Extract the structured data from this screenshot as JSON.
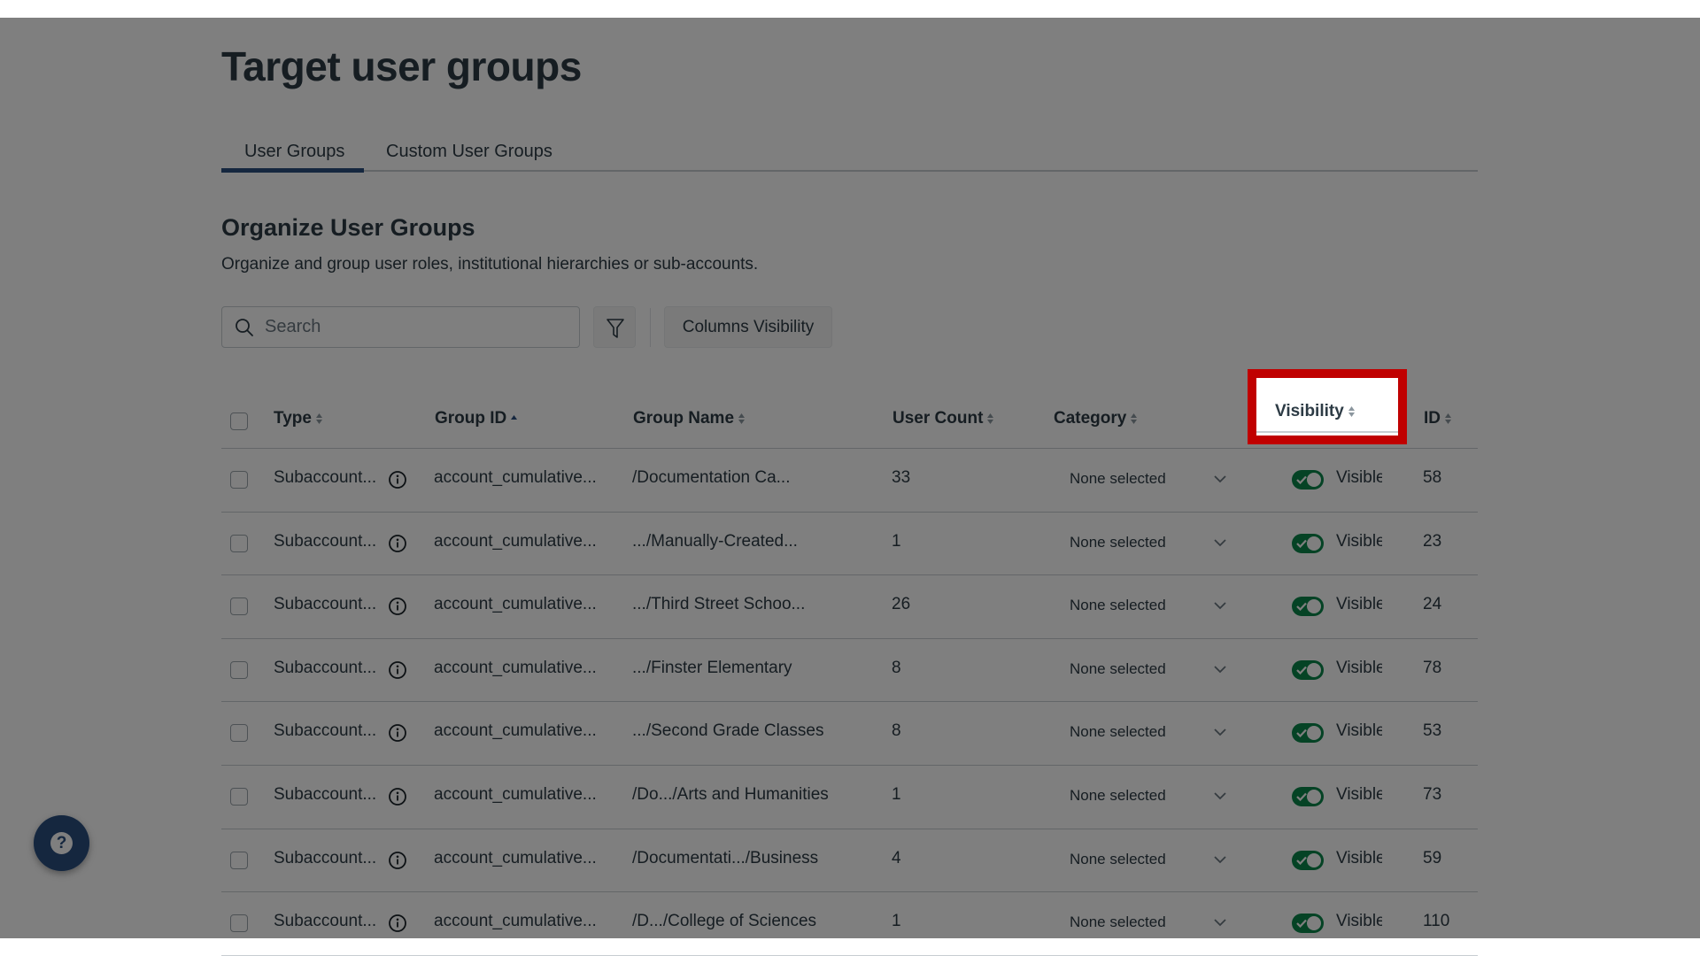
{
  "page": {
    "title": "Target user groups"
  },
  "tabs": [
    {
      "label": "User Groups",
      "active": true
    },
    {
      "label": "Custom User Groups",
      "active": false
    }
  ],
  "section": {
    "title": "Organize User Groups",
    "description": "Organize and group user roles, institutional hierarchies or sub-accounts."
  },
  "toolbar": {
    "search_placeholder": "Search",
    "search_value": "",
    "filter_icon": "filter-funnel-icon",
    "columns_visibility_label": "Columns Visibility"
  },
  "table": {
    "columns": [
      {
        "label": "Type",
        "sort": "none"
      },
      {
        "label": "Group ID",
        "sort": "ascending"
      },
      {
        "label": "Group Name",
        "sort": "none"
      },
      {
        "label": "User Count",
        "sort": "none"
      },
      {
        "label": "Category",
        "sort": "none"
      },
      {
        "label": "Visibility",
        "sort": "none",
        "highlighted": true
      },
      {
        "label": "ID",
        "sort": "none"
      }
    ],
    "rows": [
      {
        "type": "Subaccount...",
        "group_id": "account_cumulative...",
        "group_name": "/Documentation Ca...",
        "user_count": "33",
        "category": "None selected",
        "visibility": "Visible",
        "visible_on": true,
        "id": "58"
      },
      {
        "type": "Subaccount...",
        "group_id": "account_cumulative...",
        "group_name": ".../Manually-Created...",
        "user_count": "1",
        "category": "None selected",
        "visibility": "Visible",
        "visible_on": true,
        "id": "23"
      },
      {
        "type": "Subaccount...",
        "group_id": "account_cumulative...",
        "group_name": ".../Third Street Schoo...",
        "user_count": "26",
        "category": "None selected",
        "visibility": "Visible",
        "visible_on": true,
        "id": "24"
      },
      {
        "type": "Subaccount...",
        "group_id": "account_cumulative...",
        "group_name": ".../Finster Elementary",
        "user_count": "8",
        "category": "None selected",
        "visibility": "Visible",
        "visible_on": true,
        "id": "78"
      },
      {
        "type": "Subaccount...",
        "group_id": "account_cumulative...",
        "group_name": ".../Second Grade Classes",
        "user_count": "8",
        "category": "None selected",
        "visibility": "Visible",
        "visible_on": true,
        "id": "53"
      },
      {
        "type": "Subaccount...",
        "group_id": "account_cumulative...",
        "group_name": "/Do.../Arts and Humanities",
        "user_count": "1",
        "category": "None selected",
        "visibility": "Visible",
        "visible_on": true,
        "id": "73"
      },
      {
        "type": "Subaccount...",
        "group_id": "account_cumulative...",
        "group_name": "/Documentati.../Business",
        "user_count": "4",
        "category": "None selected",
        "visibility": "Visible",
        "visible_on": true,
        "id": "59"
      },
      {
        "type": "Subaccount...",
        "group_id": "account_cumulative...",
        "group_name": "/D.../College of Sciences",
        "user_count": "1",
        "category": "None selected",
        "visibility": "Visible",
        "visible_on": true,
        "id": "110"
      }
    ]
  },
  "help": {
    "icon": "question-mark-icon",
    "label": "?"
  },
  "colors": {
    "accent": "#2b4f7e",
    "toggle_on": "#0b874b",
    "highlight_border": "#c00000",
    "overlay": "rgba(0,0,0,0.5)"
  }
}
